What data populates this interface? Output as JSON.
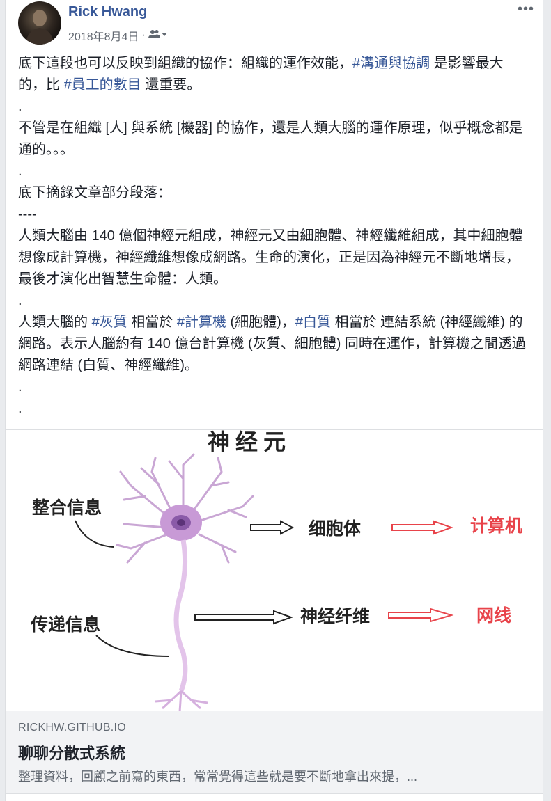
{
  "post": {
    "author": "Rick Hwang",
    "date": "2018年8月4日",
    "audience_icon": "friends-icon",
    "more_label": "•••",
    "paragraphs": [
      {
        "segments": [
          {
            "t": "底下這段也可以反映到組織的協作：組織的運作效能，"
          },
          {
            "t": "#溝通與協調",
            "tag": true
          },
          {
            "t": " 是影響最大的，比 "
          },
          {
            "t": "#員工的數目",
            "tag": true
          },
          {
            "t": " 還重要。"
          }
        ]
      },
      {
        "segments": [
          {
            "t": "."
          }
        ]
      },
      {
        "segments": [
          {
            "t": "不管是在組織 [人] 與系統 [機器] 的協作，還是人類大腦的運作原理，似乎概念都是通的。。。"
          }
        ]
      },
      {
        "segments": [
          {
            "t": "."
          }
        ]
      },
      {
        "segments": [
          {
            "t": "底下摘錄文章部分段落："
          }
        ]
      },
      {
        "segments": [
          {
            "t": "----"
          }
        ]
      },
      {
        "segments": [
          {
            "t": "人類大腦由 140 億個神經元組成，神經元又由細胞體、神經纖維組成，其中細胞體想像成計算機，神經纖維想像成網路。生命的演化，正是因為神經元不斷地增長，最後才演化出智慧生命體：人類。"
          }
        ]
      },
      {
        "segments": [
          {
            "t": "."
          }
        ]
      },
      {
        "segments": [
          {
            "t": "人類大腦的 "
          },
          {
            "t": "#灰質",
            "tag": true
          },
          {
            "t": " 相當於 "
          },
          {
            "t": "#計算機",
            "tag": true
          },
          {
            "t": " (細胞體)，"
          },
          {
            "t": "#白質",
            "tag": true
          },
          {
            "t": " 相當於 連結系統 (神經纖維) 的網路。表示人腦約有 140 億台計算機 (灰質、細胞體) 同時在運作，計算機之間透過網路連結 (白質、神經纖維)。"
          }
        ]
      },
      {
        "segments": [
          {
            "t": "."
          }
        ]
      },
      {
        "segments": [
          {
            "t": "."
          }
        ]
      }
    ]
  },
  "image": {
    "title": "神经元",
    "label_integrate": "整合信息",
    "label_transmit": "传递信息",
    "label_cellbody": "细胞体",
    "label_computer": "计算机",
    "label_fiber": "神经纤维",
    "label_network": "网线"
  },
  "link": {
    "domain": "RICKHW.GITHUB.IO",
    "title": "聊聊分散式系統",
    "description": "整理資料，回顧之前寫的東西，常常覺得這些就是要不斷地拿出來提，..."
  }
}
